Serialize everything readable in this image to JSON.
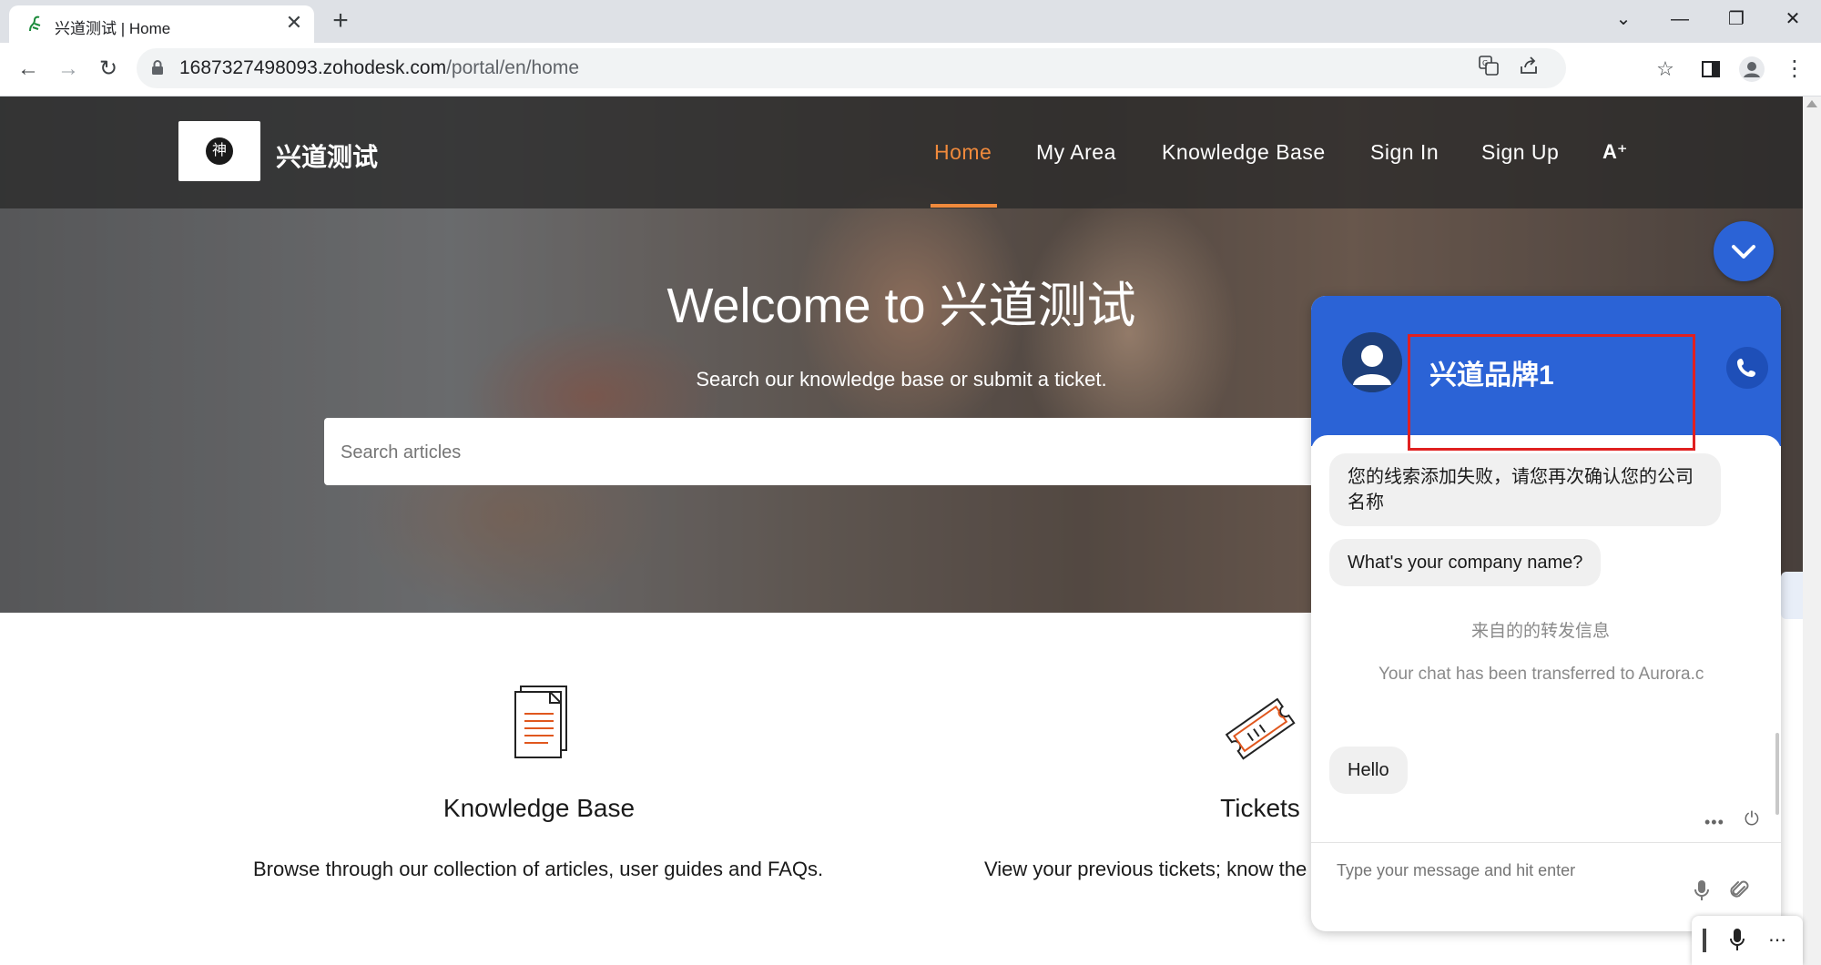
{
  "browser": {
    "tab_title": "兴道测试 | Home",
    "url_main": "1687327498093.zohodesk.com",
    "url_path": "/portal/en/home"
  },
  "site": {
    "name": "兴道测试",
    "logo_text": "神",
    "nav": [
      {
        "label": "Home",
        "active": true
      },
      {
        "label": "My Area"
      },
      {
        "label": "Knowledge Base"
      },
      {
        "label": "Sign In"
      },
      {
        "label": "Sign Up"
      }
    ],
    "a11y_icon_text": "A⁺"
  },
  "hero": {
    "title": "Welcome to 兴道测试",
    "subtitle": "Search our knowledge base or submit a ticket.",
    "search_placeholder": "Search articles"
  },
  "cards": [
    {
      "title": "Knowledge Base",
      "description": "Browse through our collection of articles, user guides and FAQs.",
      "icon": "documents-icon"
    },
    {
      "title": "Tickets",
      "description": "View your previous tickets; know the",
      "icon": "ticket-icon"
    }
  ],
  "chat": {
    "brand": "兴道品牌1",
    "messages": [
      {
        "kind": "bubble",
        "text": "您的线索添加失败，请您再次确认您的公司名称"
      },
      {
        "kind": "bubble",
        "text": "What's your company name?"
      },
      {
        "kind": "system",
        "text": "来自的的转发信息"
      },
      {
        "kind": "system",
        "text": "Your chat has been transferred to Aurora.c"
      },
      {
        "kind": "bubble",
        "text": "Hello"
      }
    ],
    "more_label": "•••",
    "input_placeholder": "Type your message and hit enter"
  },
  "colors": {
    "accent": "#f08a3c",
    "chat_blue": "#2b63d6",
    "highlight_red": "#e02020"
  }
}
